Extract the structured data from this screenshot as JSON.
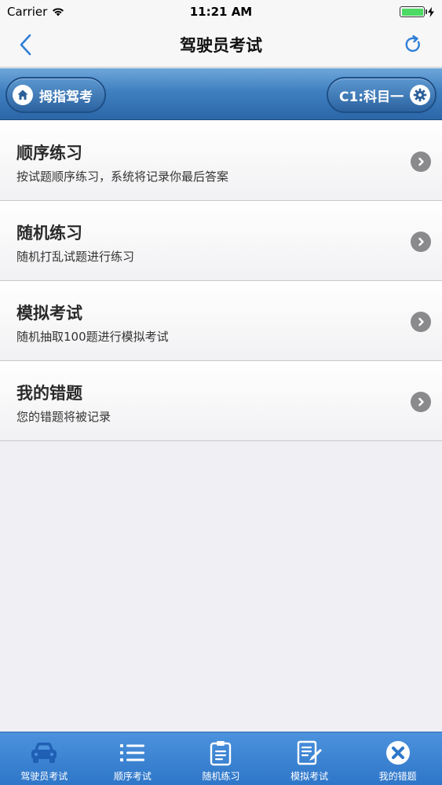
{
  "status_bar": {
    "carrier": "Carrier",
    "time": "11:21 AM"
  },
  "nav": {
    "title": "驾驶员考试"
  },
  "toolbar": {
    "home_label": "拇指驾考",
    "subject_label": "C1:科目一"
  },
  "list": [
    {
      "title": "顺序练习",
      "desc": "按试题顺序练习，系统将记录你最后答案"
    },
    {
      "title": "随机练习",
      "desc": "随机打乱试题进行练习"
    },
    {
      "title": "模拟考试",
      "desc": "随机抽取100题进行模拟考试"
    },
    {
      "title": "我的错题",
      "desc": "您的错题将被记录"
    }
  ],
  "tabs": [
    {
      "label": "驾驶员考试",
      "icon": "car-icon",
      "active": true
    },
    {
      "label": "顺序考试",
      "icon": "list-icon"
    },
    {
      "label": "随机练习",
      "icon": "clipboard-icon"
    },
    {
      "label": "模拟考试",
      "icon": "edit-document-icon"
    },
    {
      "label": "我的错题",
      "icon": "close-circle-icon"
    }
  ],
  "colors": {
    "accent": "#2e76c8",
    "active_tab_icon": "#1f5fb4",
    "battery": "#4cd964",
    "nav_icon": "#2f7fd6"
  }
}
